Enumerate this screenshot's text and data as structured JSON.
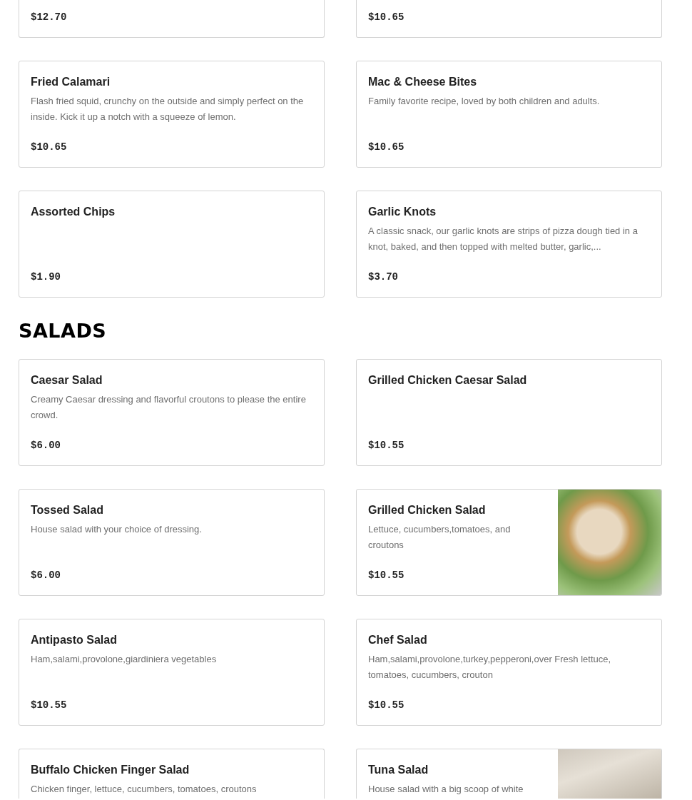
{
  "sections": [
    {
      "items": [
        {
          "kind": "cut_top",
          "price": "$12.70"
        },
        {
          "kind": "cut_top",
          "price": "$10.65"
        },
        {
          "kind": "full",
          "name": "Fried Calamari",
          "description": "Flash fried squid, crunchy on the outside and simply perfect on the inside. Kick it up a notch with a squeeze of lemon.",
          "price": "$10.65"
        },
        {
          "kind": "full",
          "name": "Mac & Cheese Bites",
          "description": "Family favorite recipe, loved by both children and adults.",
          "price": "$10.65"
        },
        {
          "kind": "full",
          "name": "Assorted Chips",
          "price": "$1.90"
        },
        {
          "kind": "full",
          "name": "Garlic Knots",
          "description": "A classic snack, our garlic knots are strips of pizza dough tied in a knot, baked, and then topped with melted butter, garlic,...",
          "price": "$3.70"
        }
      ]
    },
    {
      "heading": "SALADS",
      "items": [
        {
          "kind": "full",
          "name": "Caesar Salad",
          "description": "Creamy Caesar dressing and flavorful croutons to please the entire crowd.",
          "price": "$6.00"
        },
        {
          "kind": "full",
          "name": "Grilled Chicken Caesar Salad",
          "price": "$10.55"
        },
        {
          "kind": "full",
          "name": "Tossed Salad",
          "description": "House salad with your choice of dressing.",
          "price": "$6.00"
        },
        {
          "kind": "full",
          "name": "Grilled Chicken Salad",
          "description": "Lettuce, cucumbers,tomatoes, and croutons",
          "price": "$10.55",
          "photo": true
        },
        {
          "kind": "full",
          "name": "Antipasto Salad",
          "description": "Ham,salami,provolone,giardiniera vegetables",
          "price": "$10.55"
        },
        {
          "kind": "full",
          "name": "Chef Salad",
          "description": "Ham,salami,provolone,turkey,pepperoni,over Fresh lettuce, tomatoes, cucumbers, crouton",
          "price": "$10.55"
        },
        {
          "kind": "cut_bottom",
          "name": "Buffalo Chicken Finger Salad",
          "description": "Chicken finger, lettuce, cucumbers, tomatoes, croutons"
        },
        {
          "kind": "cut_bottom",
          "name": "Tuna Salad",
          "description": "House salad with a big scoop of white",
          "photo": true
        }
      ]
    }
  ]
}
